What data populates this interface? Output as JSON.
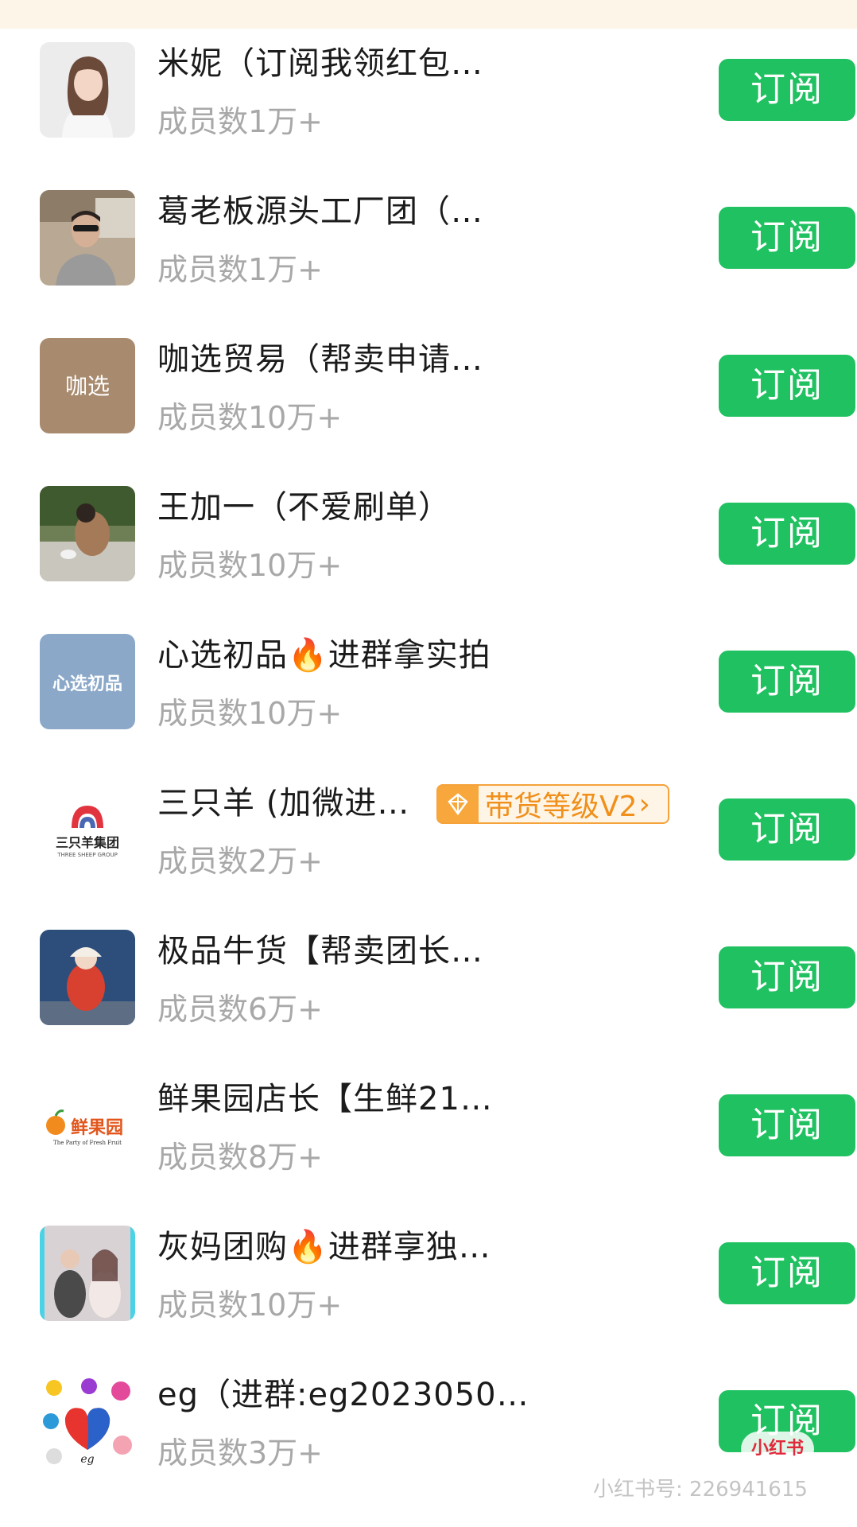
{
  "groups": [
    {
      "name": "米妮（订阅我领红包…",
      "members": "成员数1万+",
      "button": "订阅",
      "avatar": "woman-portrait"
    },
    {
      "name": "葛老板源头工厂团（…",
      "members": "成员数1万+",
      "button": "订阅",
      "avatar": "man-in-car"
    },
    {
      "name": "咖选贸易（帮卖申请…",
      "members": "成员数10万+",
      "button": "订阅",
      "avatar": "kaxuan-logo",
      "avatar_text": "咖选"
    },
    {
      "name": "王加一（不爱刷单）",
      "members": "成员数10万+",
      "button": "订阅",
      "avatar": "child-photo"
    },
    {
      "name": "心选初品🔥进群拿实拍",
      "members": "成员数10万+",
      "button": "订阅",
      "avatar": "xinxuan-logo",
      "avatar_text": "心选初品"
    },
    {
      "name": "三只羊 (加微进…",
      "members": "成员数2万+",
      "button": "订阅",
      "avatar": "three-sheep-logo",
      "avatar_text": "三只羊集团",
      "avatar_subtext": "THREE SHEEP GROUP",
      "badge": "带货等级V2"
    },
    {
      "name": "极品牛货【帮卖团长…",
      "members": "成员数6万+",
      "button": "订阅",
      "avatar": "child-red-coat"
    },
    {
      "name": "鲜果园店长【生鲜21…",
      "members": "成员数8万+",
      "button": "订阅",
      "avatar": "fresh-fruit-logo",
      "avatar_text": "鲜果园",
      "avatar_subtext": "The Party of Fresh Fruit"
    },
    {
      "name": "灰妈团购🔥进群享独…",
      "members": "成员数10万+",
      "button": "订阅",
      "avatar": "couple-photo"
    },
    {
      "name": "eg（进群:eg2023050…",
      "members": "成员数3万+",
      "button": "订阅",
      "avatar": "eg-logo",
      "avatar_text": "eg"
    }
  ],
  "watermark": {
    "logo": "小红书",
    "account": "小红书号: 226941615"
  },
  "colors": {
    "subscribe_green": "#1fc160",
    "badge_orange": "#f5a23a",
    "top_strip": "#fdf6e8"
  }
}
